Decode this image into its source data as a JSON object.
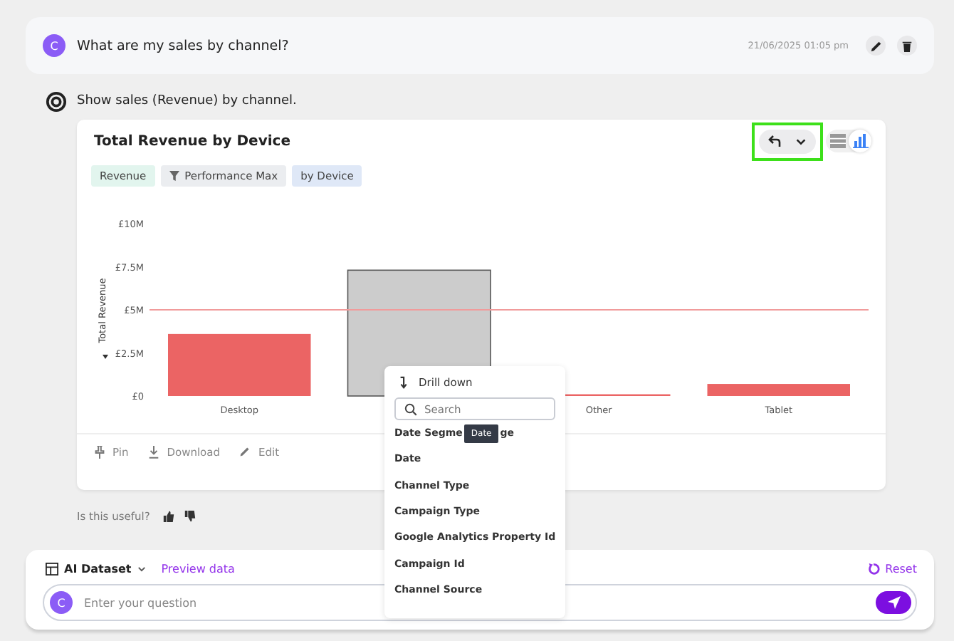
{
  "question": {
    "avatar": "C",
    "text": "What are my sales by channel?",
    "timestamp": "21/06/2025 01:05 pm"
  },
  "answer": {
    "text": "Show sales (Revenue) by channel."
  },
  "card": {
    "title": "Total Revenue by Device",
    "chips": [
      {
        "label": "Revenue",
        "kind": "metric"
      },
      {
        "label": "Performance Max",
        "kind": "filter"
      },
      {
        "label": "by Device",
        "kind": "group"
      }
    ],
    "view_toggle": [
      {
        "kind": "table",
        "selected": false
      },
      {
        "kind": "chart",
        "selected": true
      }
    ],
    "chart_data": {
      "type": "bar",
      "ylabel": "Total Revenue",
      "categories": [
        "Desktop",
        null,
        "Other",
        "Tablet"
      ],
      "series": [
        {
          "color": "#eb6464",
          "values": [
            3600000,
            null,
            100000,
            700000
          ]
        },
        {
          "color": "#cccccc",
          "values": [
            null,
            7300000,
            null,
            null
          ]
        }
      ],
      "ylim": [
        0,
        10000000
      ],
      "yticks": [
        {
          "value": 0,
          "label": "£0"
        },
        {
          "value": 2500000,
          "label": "£2.5M"
        },
        {
          "value": 5000000,
          "label": "£5M"
        },
        {
          "value": 7500000,
          "label": "£7.5M"
        },
        {
          "value": 10000000,
          "label": "£10M"
        }
      ],
      "ref_lines": [
        {
          "axis": "y",
          "value": 5000000
        }
      ]
    },
    "actions": [
      "Pin",
      "Download",
      "Edit"
    ]
  },
  "feedback": {
    "text": "Is this useful?"
  },
  "menu": {
    "title": "Drill down",
    "search_placeholder": "Search",
    "items": [
      {
        "label": "Date Segme",
        "tooltip": "Date",
        "label_end": "ge"
      },
      {
        "label": "Date"
      },
      {
        "label": "Channel Type"
      },
      {
        "label": "Campaign Type"
      },
      {
        "label": "Google Analytics Property Id"
      },
      {
        "label": "Campaign Id"
      },
      {
        "label": "Channel Source"
      }
    ]
  },
  "composer": {
    "dataset": "AI Dataset",
    "preview": "Preview data",
    "reset": "Reset",
    "avatar": "C",
    "placeholder": "Enter your question"
  }
}
